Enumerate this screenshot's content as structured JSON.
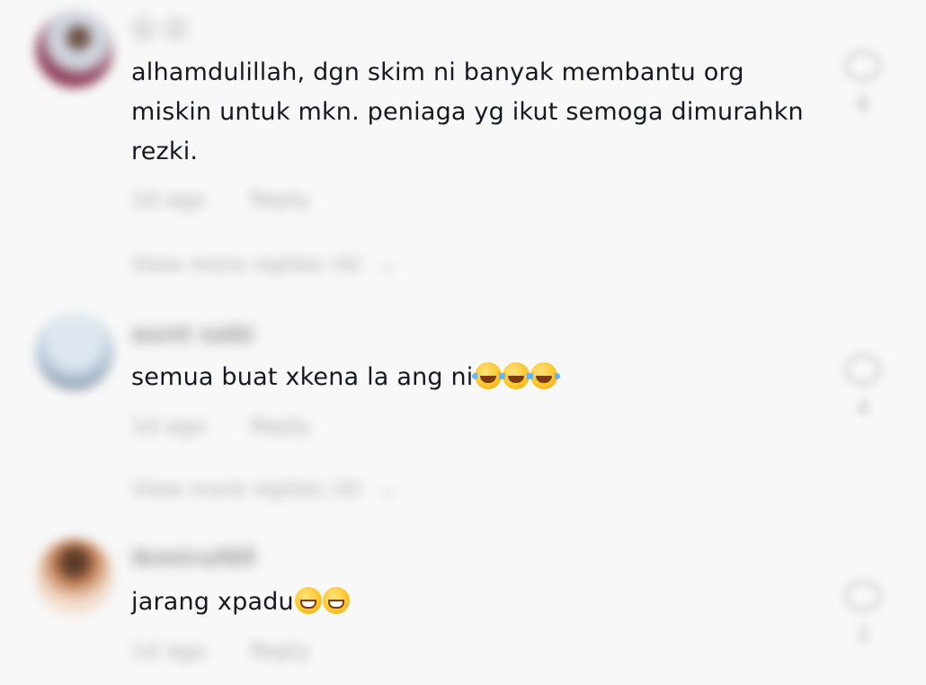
{
  "comments": [
    {
      "username": "☺ ☺",
      "text": "alhamdulillah, dgn skim ni banyak membantu org miskin untuk mkn. peniaga yg ikut semoga dimurahkn rezki.",
      "emojis": [],
      "time": "1d ago",
      "reply_label": "Reply",
      "view_replies": "View more replies (4)",
      "like_count": "6",
      "avatar_colors": [
        "#7a5a4e",
        "#c0c6d3",
        "#8c3b57"
      ]
    },
    {
      "username": "aunt sabi",
      "text": "semua buat xkena la ang ni",
      "emojis": [
        "joy",
        "joy",
        "joy"
      ],
      "time": "1d ago",
      "reply_label": "Reply",
      "view_replies": "View more replies (4)",
      "like_count": "4",
      "avatar_colors": [
        "#b7c9dc",
        "#d7e3ee",
        "#4c5a68"
      ]
    },
    {
      "username": "ikmirul60",
      "text": "jarang xpadu",
      "emojis": [
        "grin",
        "grin"
      ],
      "time": "1d ago",
      "reply_label": "Reply",
      "view_replies": "",
      "like_count": "2",
      "avatar_colors": [
        "#ffffff",
        "#b9774e",
        "#523223"
      ]
    }
  ]
}
